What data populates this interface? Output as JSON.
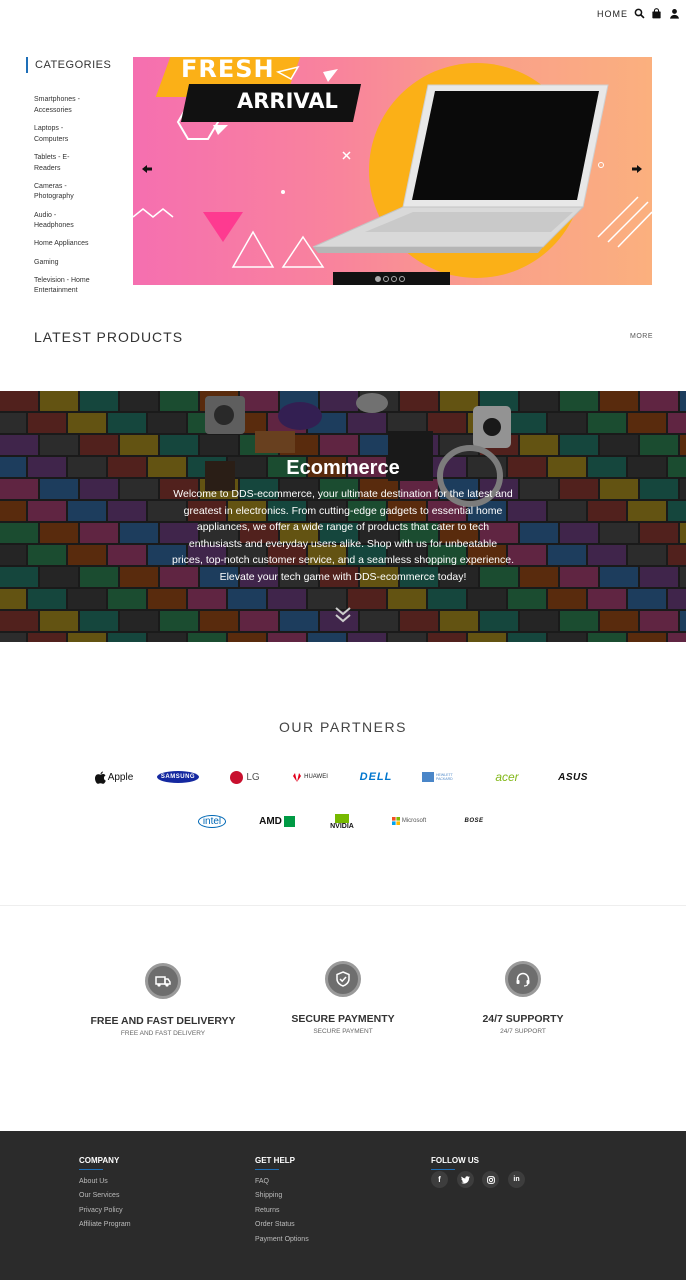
{
  "nav": {
    "home_label": "HOME",
    "icons": [
      "search-icon",
      "bag-icon",
      "user-icon"
    ]
  },
  "categories": {
    "title": "CATEGORIES",
    "items": [
      "Smartphones - Accessories",
      "Laptops - Computers",
      "Tablets - E-Readers",
      "Cameras - Photography",
      "Audio - Headphones",
      "Home Appliances",
      "Gaming",
      "Television - Home Entertainment"
    ]
  },
  "slider": {
    "headline_1": "FRESH",
    "headline_2": "ARRIVAL",
    "slide_count": 4,
    "active_slide": 1
  },
  "latest": {
    "title": "LATEST PRODUCTS",
    "more_label": "MORE"
  },
  "hero": {
    "title": "Ecommerce",
    "text": "Welcome to DDS-ecommerce, your ultimate destination for the latest and greatest in electronics. From cutting-edge gadgets to essential home appliances, we offer a wide range of products that cater to tech enthusiasts and everyday users alike. Shop with us for unbeatable prices, top-notch customer service, and a seamless shopping experience. Elevate your tech game with DDS-ecommerce today!"
  },
  "partners": {
    "title": "OUR PARTNERS",
    "row1": [
      "Apple",
      "SAMSUNG",
      "LG",
      "HUAWEI",
      "DELL",
      "HEWLETT PACKARD",
      "acer",
      "ASUS"
    ],
    "row2": [
      "intel",
      "AMD",
      "NVIDIA",
      "Microsoft",
      "BOSE"
    ]
  },
  "features": [
    {
      "title": "FREE AND FAST DELIVERYY",
      "sub": "FREE AND FAST DELIVERY",
      "icon": "truck-icon"
    },
    {
      "title": "SECURE PAYMENTY",
      "sub": "SECURE PAYMENT",
      "icon": "shield-icon"
    },
    {
      "title": "24/7 SUPPORTY",
      "sub": "24/7 SUPPORT",
      "icon": "headset-icon"
    }
  ],
  "footer": {
    "company": {
      "title": "COMPANY",
      "links": [
        "About Us",
        "Our Services",
        "Privacy Policy",
        "Affiliate Program"
      ]
    },
    "help": {
      "title": "GET HELP",
      "links": [
        "FAQ",
        "Shipping",
        "Returns",
        "Order Status",
        "Payment Options"
      ]
    },
    "follow": {
      "title": "FOLLOW US",
      "icons": [
        "facebook-icon",
        "twitter-icon",
        "instagram-icon",
        "linkedin-icon"
      ]
    }
  },
  "colors": {
    "accent": "#1e6fb8",
    "footer_bg": "#2b2b2b",
    "slider_pink": "#f56fb0",
    "slider_yellow": "#fbb017"
  }
}
